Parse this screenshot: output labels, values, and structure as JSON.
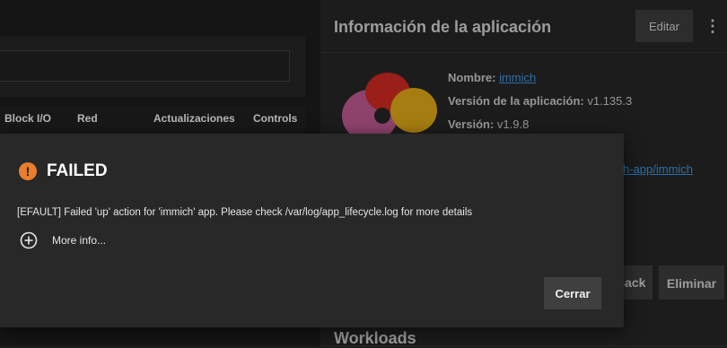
{
  "table": {
    "columns": [
      "Block I/O",
      "Red",
      "Actualizaciones",
      "Controls"
    ]
  },
  "app_info": {
    "title": "Información de la aplicación",
    "edit_label": "Editar",
    "kebab_glyph": "⋮",
    "name_label": "Nombre:",
    "name_value": "immich",
    "app_version_label": "Versión de la aplicación:",
    "app_version_value": "v1.135.3",
    "version_label": "Versión:",
    "version_value": "v1.9.8",
    "link_fragment": "h-app/immich"
  },
  "actions": {
    "back_fragment": "Back",
    "delete_label": "Eliminar"
  },
  "workloads": {
    "title": "Workloads"
  },
  "dialog": {
    "title": "FAILED",
    "icon_glyph": "!",
    "message": "[EFAULT] Failed 'up' action for 'immich' app. Please check /var/log/app_lifecycle.log for more details",
    "more_info_label": "More info...",
    "close_label": "Cerrar"
  },
  "colors": {
    "error_accent": "#e87e2e",
    "link": "#3a8fd6"
  },
  "icons": {
    "error": "alert-circle-icon",
    "more_info": "plus-circle-icon",
    "menu": "kebab-menu-icon",
    "logo": "immich-logo-icon"
  }
}
